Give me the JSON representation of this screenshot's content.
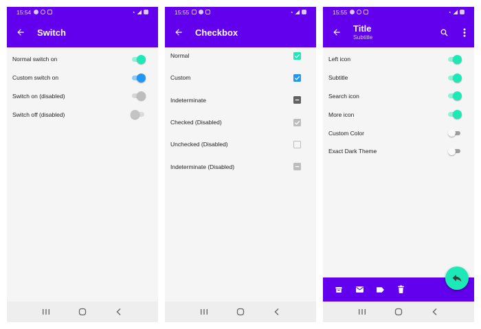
{
  "colors": {
    "primary": "#6200ee",
    "teal_accent": "#1de9b6",
    "custom_blue": "#2196f3",
    "background": "#f5f5f5"
  },
  "screens": [
    {
      "status": {
        "time": "15:54"
      },
      "appbar": {
        "title": "Switch",
        "nav_icon": "arrow-back-icon"
      },
      "switches": [
        {
          "label": "Normal switch on",
          "state": "on",
          "color": "teal"
        },
        {
          "label": "Custom switch on",
          "state": "on",
          "color": "blue"
        },
        {
          "label": "Switch on (disabled)",
          "state": "on",
          "color": "disabled"
        },
        {
          "label": "Switch off (disabled)",
          "state": "off",
          "color": "disabled"
        }
      ]
    },
    {
      "status": {
        "time": "15:55"
      },
      "appbar": {
        "title": "Checkbox",
        "nav_icon": "arrow-back-icon"
      },
      "checkboxes": [
        {
          "label": "Normal",
          "state": "checked",
          "color": "teal"
        },
        {
          "label": "Custom",
          "state": "checked",
          "color": "blue"
        },
        {
          "label": "Indeterminate",
          "state": "indeterminate",
          "color": "dark"
        },
        {
          "label": "Checked (Disabled)",
          "state": "checked",
          "color": "disabled"
        },
        {
          "label": "Unchecked (Disabled)",
          "state": "unchecked",
          "color": "disabled"
        },
        {
          "label": "Indeterminate (Disabled)",
          "state": "indeterminate",
          "color": "disabled"
        }
      ]
    },
    {
      "status": {
        "time": "15:55"
      },
      "appbar": {
        "title": "Title",
        "subtitle": "Subtitle",
        "nav_icon": "arrow-back-icon",
        "actions": [
          "search-icon",
          "more-vert-icon"
        ]
      },
      "switches": [
        {
          "label": "Left icon",
          "state": "on",
          "color": "teal"
        },
        {
          "label": "Subtitle",
          "state": "on",
          "color": "teal"
        },
        {
          "label": "Search icon",
          "state": "on",
          "color": "teal"
        },
        {
          "label": "More icon",
          "state": "on",
          "color": "teal"
        },
        {
          "label": "Custom Color",
          "state": "off",
          "color": "plain"
        },
        {
          "label": "Exact Dark Theme",
          "state": "off",
          "color": "plain"
        }
      ],
      "bottom_bar_icons": [
        "archive-icon",
        "mail-icon",
        "label-icon",
        "delete-icon"
      ],
      "fab_icon": "reply-icon"
    }
  ],
  "system_nav": [
    "recents-icon",
    "home-icon",
    "back-icon"
  ]
}
